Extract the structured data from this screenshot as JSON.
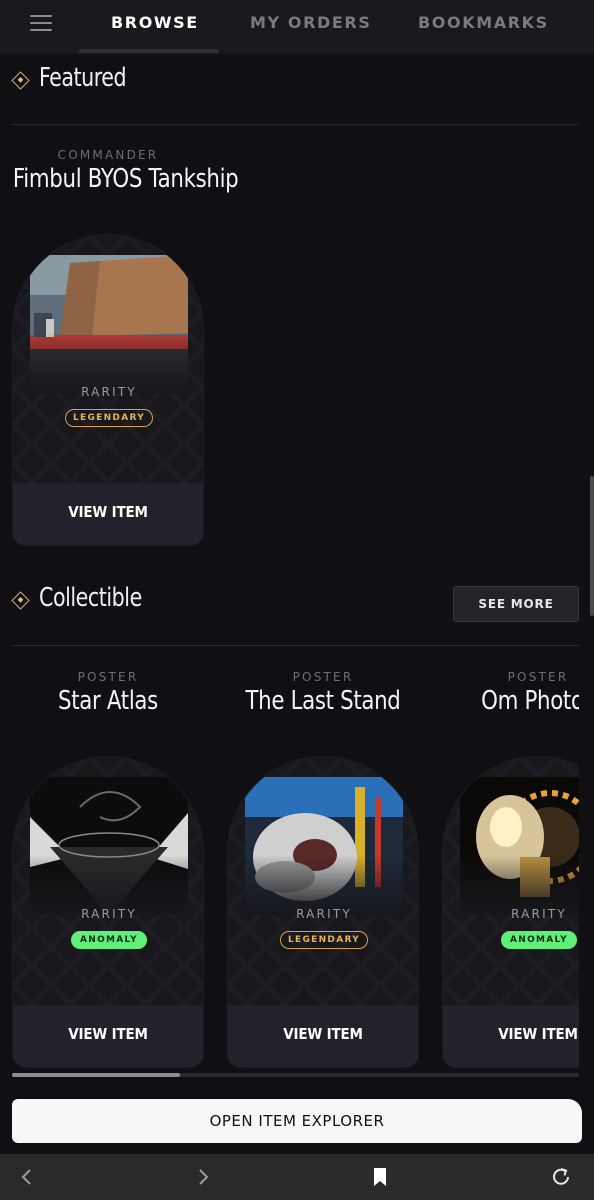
{
  "nav": {
    "menu_icon": "hamburger-icon",
    "tabs": [
      {
        "label": "BROWSE",
        "active": true
      },
      {
        "label": "MY ORDERS",
        "active": false
      },
      {
        "label": "BOOKMARKS",
        "active": false
      }
    ]
  },
  "featured": {
    "title": "Featured",
    "item": {
      "category": "COMMANDER",
      "name": "Fimbul BYOS Tankship",
      "rarity_label": "RARITY",
      "rarity": "LEGENDARY",
      "button": "VIEW ITEM"
    }
  },
  "collectible": {
    "title": "Collectible",
    "see_more": "SEE MORE",
    "items": [
      {
        "category": "POSTER",
        "name": "Star Atlas",
        "rarity_label": "RARITY",
        "rarity": "ANOMALY",
        "button": "VIEW ITEM"
      },
      {
        "category": "POSTER",
        "name": "The Last Stand",
        "rarity_label": "RARITY",
        "rarity": "LEGENDARY",
        "button": "VIEW ITEM"
      },
      {
        "category": "POSTER",
        "name": "Om Photoli",
        "rarity_label": "RARITY",
        "rarity": "ANOMALY",
        "button": "VIEW ITEM"
      }
    ]
  },
  "explorer_button": "OPEN ITEM EXPLORER",
  "browser_bar": {
    "icons": [
      "back-icon",
      "forward-icon",
      "bookmark-icon",
      "reload-icon"
    ]
  },
  "colors": {
    "background": "#101014",
    "legendary": "#d9a441",
    "anomaly": "#5ff07a",
    "accent_diamond": "#c9ae72"
  }
}
